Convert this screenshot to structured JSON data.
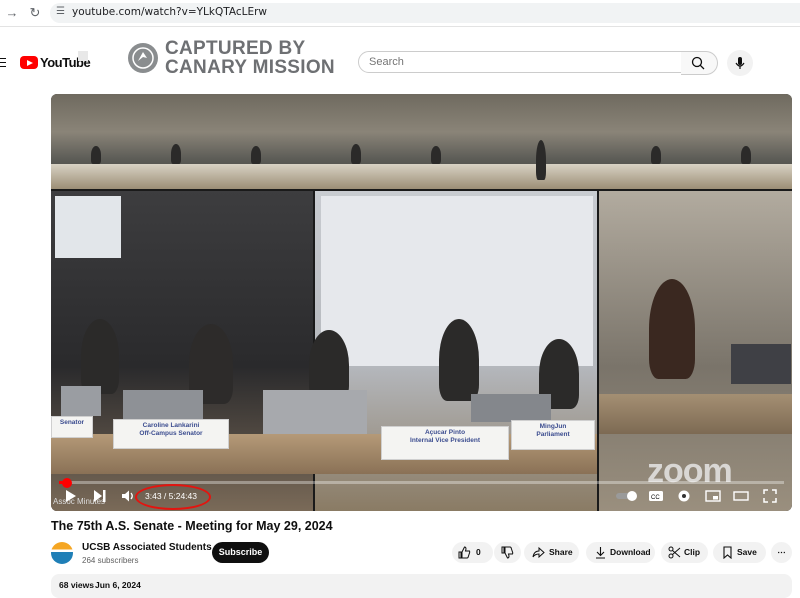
{
  "browser": {
    "url": "youtube.com/watch?v=YLkQTAcLErw"
  },
  "header": {
    "logo_text": "YouTube",
    "overlay_line1": "CAPTURED BY",
    "overlay_line2": "CANARY MISSION",
    "search_placeholder": "Search"
  },
  "video": {
    "current_time": "3:43",
    "duration": "5:24:43",
    "time_display": "3:43 / 5:24:43",
    "progress_fraction": 0.011,
    "zoom_watermark": "zoom",
    "corner_label": "Assoc Minutes",
    "nameplates": [
      "Caroline Lankarini\nOff-Campus Senator",
      "Açucar Pinto\nInternal Vice President",
      "MingJun\nParliament",
      "Senator"
    ]
  },
  "meta": {
    "title": "The 75th A.S. Senate - Meeting for May 29, 2024",
    "channel_name": "UCSB Associated Students",
    "subscribers": "264 subscribers",
    "subscribe_label": "Subscribe",
    "like_count": "0",
    "share_label": "Share",
    "download_label": "Download",
    "clip_label": "Clip",
    "save_label": "Save",
    "views": "68 views",
    "date": "Jun 6, 2024"
  }
}
